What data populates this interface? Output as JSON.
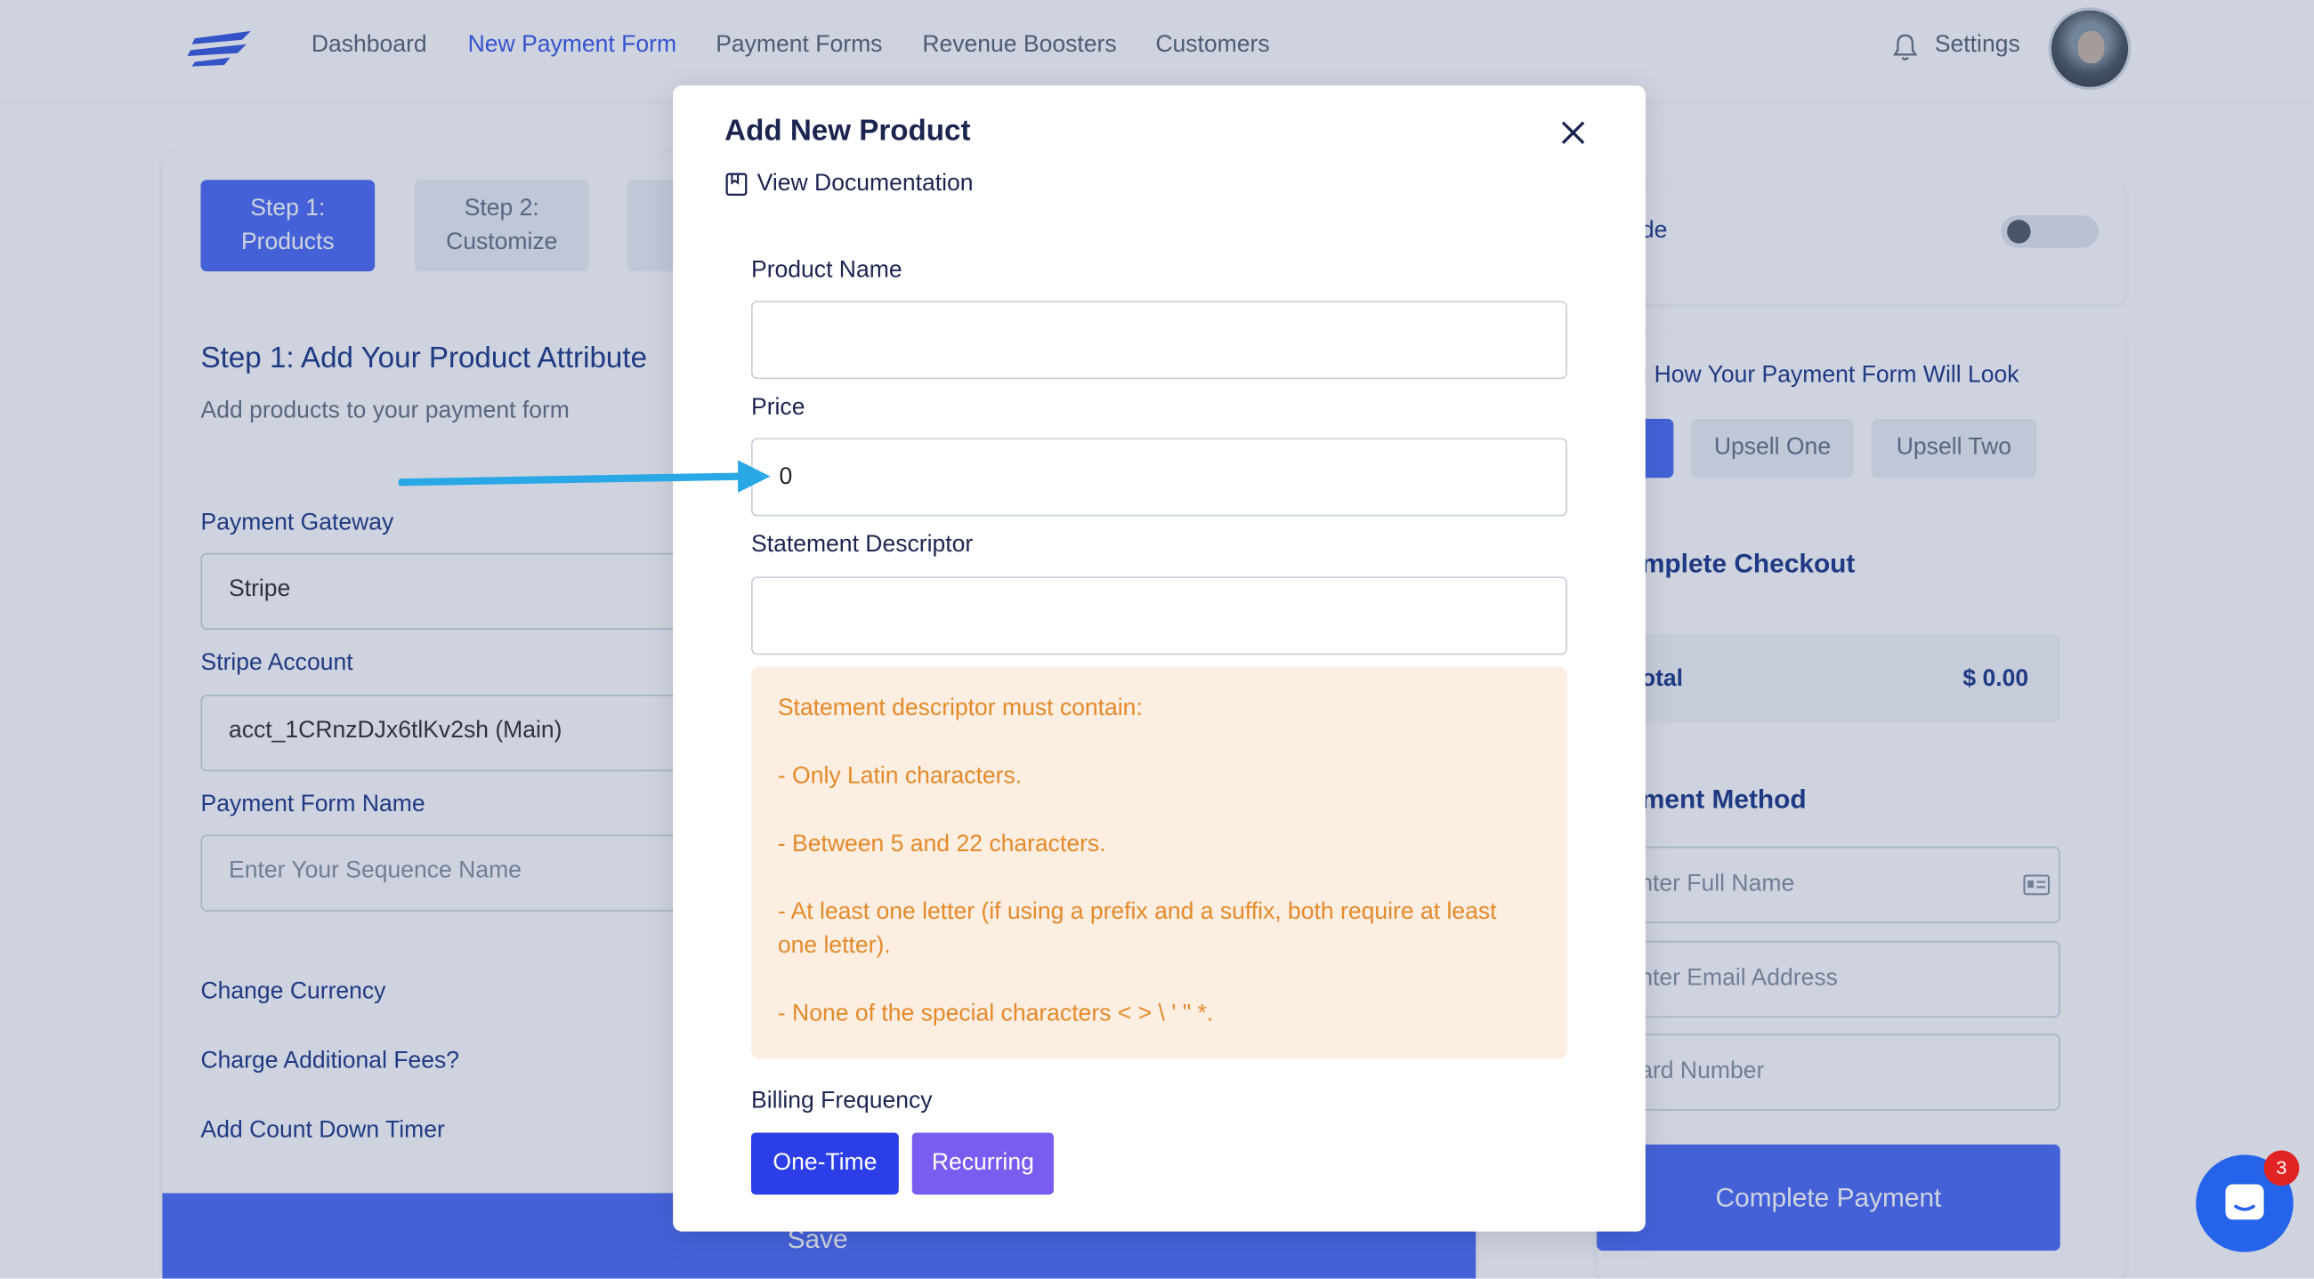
{
  "nav": {
    "items": [
      "Dashboard",
      "New Payment Form",
      "Payment Forms",
      "Revenue Boosters",
      "Customers"
    ],
    "active_index": 1,
    "settings": "Settings"
  },
  "steps": {
    "step1_line1": "Step 1:",
    "step1_line2": "Products",
    "step2_line1": "Step 2:",
    "step2_line2": "Customize"
  },
  "left": {
    "title": "Step 1: Add Your Product Attribute",
    "subtitle": "Add products to your payment form",
    "gateway_label": "Payment Gateway",
    "gateway_value": "Stripe",
    "account_label": "Stripe Account",
    "account_value": "acct_1CRnzDJx6tlKv2sh (Main)",
    "form_name_label": "Payment Form Name",
    "form_name_placeholder": "Enter Your Sequence Name",
    "change_currency": "Change Currency",
    "additional_fees": "Charge Additional Fees?",
    "countdown": "Add Count Down Timer",
    "save": "Save"
  },
  "right": {
    "mode_fragment": "de",
    "preview_fragment": ": How Your Payment Form Will Look",
    "upsell_one": "Upsell One",
    "upsell_two": "Upsell Two",
    "checkout_fragment": "mplete Checkout",
    "total_fragment": "otal",
    "total_value": "$ 0.00",
    "payment_method_fragment": "ment Method",
    "full_name_fragment": "nter Full Name",
    "email_fragment": "nter Email Address",
    "card_fragment": "ard Number",
    "complete_payment": "Complete Payment"
  },
  "modal": {
    "title": "Add New Product",
    "view_docs": "View Documentation",
    "product_name_label": "Product Name",
    "product_name_value": "",
    "price_label": "Price",
    "price_value": "0",
    "descriptor_label": "Statement Descriptor",
    "descriptor_value": "",
    "warning": [
      "Statement descriptor must contain:",
      "- Only Latin characters.",
      "- Between 5 and 22 characters.",
      "- At least one letter (if using a prefix and a suffix, both require at least one letter).",
      "- None of the special characters < > \\ ' \" *."
    ],
    "billing_label": "Billing Frequency",
    "one_time": "One-Time",
    "recurring": "Recurring"
  },
  "chat": {
    "badge": "3"
  },
  "colors": {
    "primary": "#4f6ef7",
    "one_time": "#2b3ee8",
    "recurring": "#7b5cf0",
    "warning_bg": "#fdeee2",
    "warning_text": "#e48a2a",
    "annotation_arrow": "#2aa8e6"
  }
}
